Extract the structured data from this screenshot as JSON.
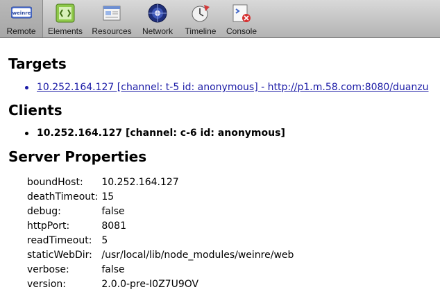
{
  "toolbar": {
    "tabs": [
      {
        "label": "Remote",
        "icon": "weinre-logo-icon",
        "icon_text": "weinre",
        "selected": true
      },
      {
        "label": "Elements",
        "icon": "elements-icon"
      },
      {
        "label": "Resources",
        "icon": "resources-icon"
      },
      {
        "label": "Network",
        "icon": "network-icon"
      },
      {
        "label": "Timeline",
        "icon": "timeline-icon"
      },
      {
        "label": "Console",
        "icon": "console-icon"
      }
    ]
  },
  "sections": {
    "targets_title": "Targets",
    "clients_title": "Clients",
    "server_title": "Server Properties"
  },
  "targets": [
    {
      "text": "10.252.164.127 [channel: t-5 id: anonymous] - http://p1.m.58.com:8080/duanzu"
    }
  ],
  "clients": [
    {
      "text": "10.252.164.127 [channel: c-6 id: anonymous]"
    }
  ],
  "server_properties": [
    {
      "key": "boundHost:",
      "value": "10.252.164.127"
    },
    {
      "key": "deathTimeout:",
      "value": "15"
    },
    {
      "key": "debug:",
      "value": "false"
    },
    {
      "key": "httpPort:",
      "value": "8081"
    },
    {
      "key": "readTimeout:",
      "value": "5"
    },
    {
      "key": "staticWebDir:",
      "value": "/usr/local/lib/node_modules/weinre/web"
    },
    {
      "key": "verbose:",
      "value": "false"
    },
    {
      "key": "version:",
      "value": "2.0.0-pre-I0Z7U9OV"
    }
  ],
  "colors": {
    "link": "#1a1aa6",
    "toolbar_top": "#d9d9d9",
    "toolbar_bottom": "#b3b3b3"
  }
}
